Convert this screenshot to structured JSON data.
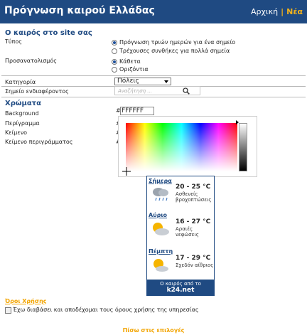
{
  "header": {
    "title": "Πρόγνωση καιρού Ελλάδας",
    "home": "Αρχική",
    "separator": "|",
    "new": "Νέα"
  },
  "settings": {
    "section_title": "Ο καιρός στο site σας",
    "type_label": "Τύπος",
    "type_options": [
      "Πρόγνωση τριών ημερών για ένα σημείο",
      "Τρέχουσες συνθήκες για πολλά σημεία"
    ],
    "orientation_label": "Προσανατολισμός",
    "orientation_options": [
      "Κάθετα",
      "Οριζόντια"
    ],
    "category_label": "Κατηγορία",
    "category_value": "Πόλεις",
    "poi_label": "Σημείο ενδιαφέροντος",
    "poi_placeholder": "Αναζήτηση ..."
  },
  "colors": {
    "section_title": "Χρώματα",
    "background_label": "Background",
    "border_label": "Περίγραμμα",
    "text_label": "Κείμενο",
    "border_text_label": "Κείμενο περιγράμματος",
    "hash": "#",
    "background_value": "FFFFFF",
    "accent": "#1f4a82",
    "highlight": "#f2a400"
  },
  "widget": {
    "days": [
      {
        "name": "Σήμερα",
        "temp": "20 - 25 °C",
        "condition": "Ασθενείς βροχοπτώσεις",
        "icon": "rain-cloud-icon"
      },
      {
        "name": "Αύριο",
        "temp": "16 - 27 °C",
        "condition": "Αραιές νεφώσεις",
        "icon": "sun-cloud-icon"
      },
      {
        "name": "Πέμπτη",
        "temp": "17 - 29 °C",
        "condition": "Σχεδόν αίθριος",
        "icon": "sun-cloud-icon"
      }
    ],
    "footer_line1": "Ο καιρός από το",
    "footer_line2": "k24.net"
  },
  "terms": {
    "title": "Όροι Χρήσης",
    "accept_text": "Έχω διαβάσει και αποδέχομαι τους όρους χρήσης της υπηρεσίας"
  },
  "back_link": "Πίσω στις επιλογές"
}
